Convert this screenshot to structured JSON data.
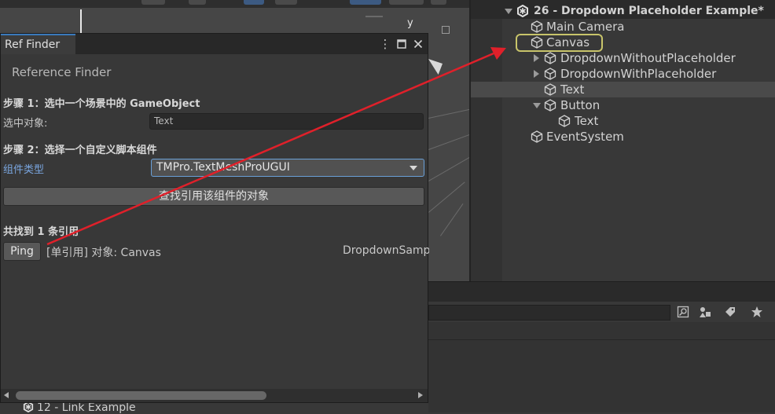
{
  "scene": {
    "axis_label": "y"
  },
  "hierarchy": {
    "rows": [
      {
        "label": "26 - Dropdown Placeholder Example*"
      },
      {
        "label": "Main Camera"
      },
      {
        "label": "Canvas"
      },
      {
        "label": "DropdownWithoutPlaceholder"
      },
      {
        "label": "DropdownWithPlaceholder"
      },
      {
        "label": "Text"
      },
      {
        "label": "Button"
      },
      {
        "label": "Text"
      },
      {
        "label": "EventSystem"
      }
    ]
  },
  "project": {
    "list_item": "12 - Link Example"
  },
  "ref_finder": {
    "tab_label": "Ref Finder",
    "menu_icon": "⋮",
    "title": "Reference Finder",
    "step1": "步骤 1：选中一个场景中的 GameObject",
    "selected_label": "选中对象:",
    "selected_value": "Text",
    "step2": "步骤 2：选择一个自定义脚本组件",
    "component_label": "组件类型",
    "component_value": "TMPro.TextMeshProUGUI",
    "find_button": "查找引用该组件的对象",
    "result_header": "共找到 1 条引用",
    "ping_button": "Ping",
    "ref_text": "[单引用] 对象: Canvas",
    "ref_path": "DropdownSamp"
  },
  "colors": {
    "accent": "#3a79bb",
    "highlight_ring": "#c8c46a",
    "annotation_arrow": "#e0202a"
  }
}
